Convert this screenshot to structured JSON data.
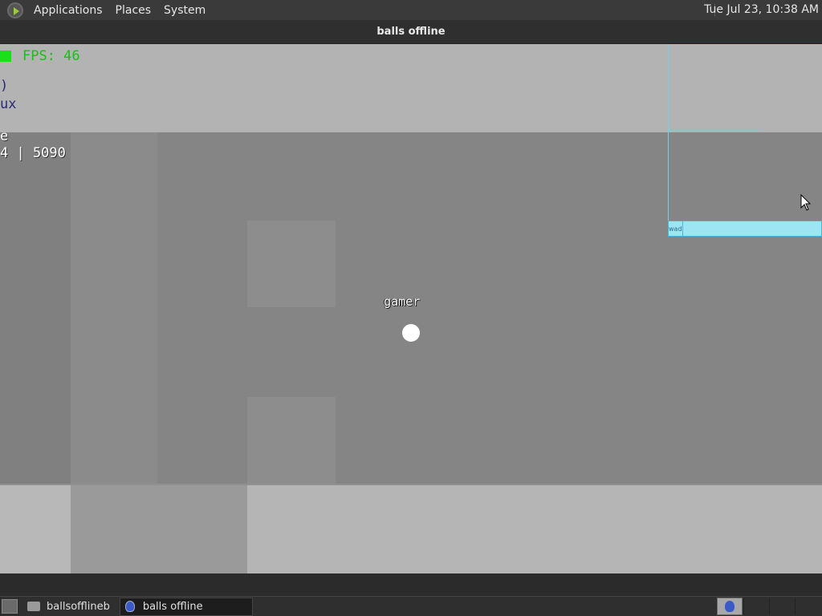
{
  "topbar": {
    "menus": [
      "Applications",
      "Places",
      "System"
    ],
    "clock": "Tue Jul 23, 10:38 AM"
  },
  "window": {
    "title": "balls offline"
  },
  "hud": {
    "fps": "FPS: 46",
    "line1": ")",
    "line2": "ux",
    "line3": "e",
    "line4": "4 | 5090"
  },
  "game": {
    "player_name": "gamer"
  },
  "chat": {
    "tag": "wad"
  },
  "taskbar": {
    "tasks": [
      "ballsofflineb",
      "balls offline"
    ]
  }
}
